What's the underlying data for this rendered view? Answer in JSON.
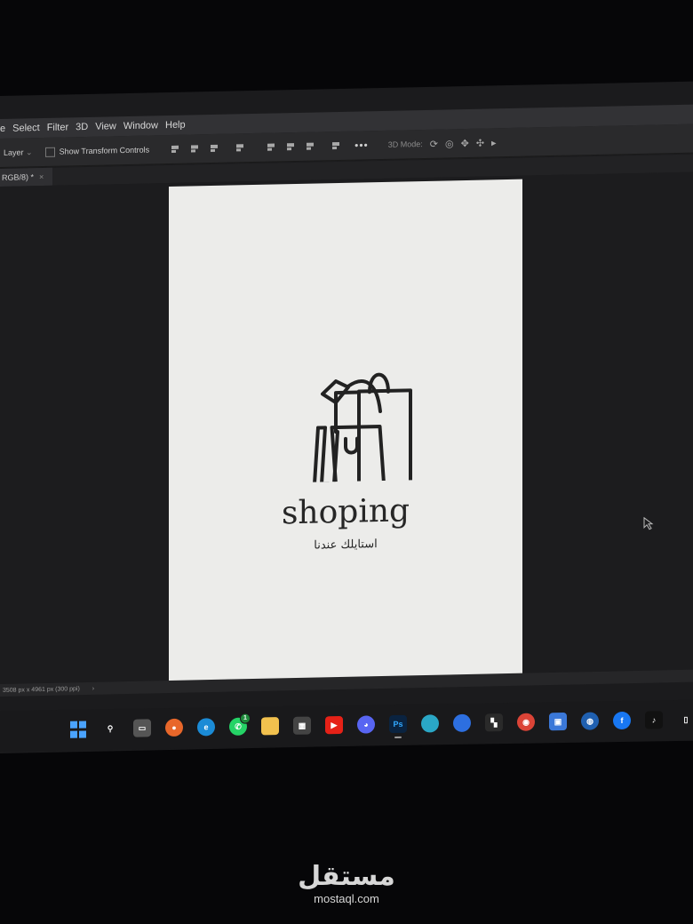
{
  "menu": {
    "items": [
      "e",
      "Select",
      "Filter",
      "3D",
      "View",
      "Window",
      "Help"
    ]
  },
  "options_bar": {
    "layer_label": "Layer",
    "show_transform_controls": "Show Transform Controls",
    "more_label": "•••",
    "mode_3d_label": "3D Mode:"
  },
  "document_tab": {
    "title": "RGB/8) *",
    "close_glyph": "×"
  },
  "canvas": {
    "brand_text": "shoping",
    "tagline_text": "استايلك عندنا"
  },
  "status_bar": {
    "dimensions_text": "3508 px x 4961 px (300 ppi)",
    "arrow_glyph": "›"
  },
  "taskbar": {
    "icons": [
      {
        "name": "windows-start-icon",
        "label": "",
        "color": "#4aa3ff"
      },
      {
        "name": "search-icon",
        "label": "⚲",
        "color": "transparent"
      },
      {
        "name": "task-view-icon",
        "label": "▭",
        "color": "#555"
      },
      {
        "name": "firefox-icon",
        "label": "●",
        "color": "#e8672a"
      },
      {
        "name": "edge-icon",
        "label": "e",
        "color": "#1b8bd6"
      },
      {
        "name": "whatsapp-icon",
        "label": "✆",
        "color": "#25d366",
        "badge": "1"
      },
      {
        "name": "file-explorer-icon",
        "label": "",
        "color": "#f2c14e"
      },
      {
        "name": "microsoft-store-icon",
        "label": "▦",
        "color": "#444"
      },
      {
        "name": "youtube-icon",
        "label": "▶",
        "color": "#e62117"
      },
      {
        "name": "discord-icon",
        "label": "◕",
        "color": "#5865f2"
      },
      {
        "name": "photoshop-icon",
        "label": "Ps",
        "color": "#0a2340",
        "active": true
      },
      {
        "name": "app-blue-1-icon",
        "label": "",
        "color": "#2aa7c6"
      },
      {
        "name": "app-blue-2-icon",
        "label": "",
        "color": "#2d6fe0"
      },
      {
        "name": "capcut-icon",
        "label": "▚",
        "color": "#2a2a2a"
      },
      {
        "name": "chrome-icon",
        "label": "◉",
        "color": "#db4437"
      },
      {
        "name": "app-screen-icon",
        "label": "▣",
        "color": "#3b78d8"
      },
      {
        "name": "globe-icon",
        "label": "◍",
        "color": "#2060b0"
      },
      {
        "name": "facebook-icon",
        "label": "f",
        "color": "#1877f2"
      },
      {
        "name": "tiktok-icon",
        "label": "♪",
        "color": "#111"
      },
      {
        "name": "battery-icon",
        "label": "▯",
        "color": "transparent"
      }
    ]
  },
  "watermark": {
    "arabic": "مستقل",
    "latin": "mostaql.com"
  },
  "colors": {
    "screen_bg": "#1b1b1d",
    "canvas_bg": "#ececea",
    "ink": "#262626"
  }
}
